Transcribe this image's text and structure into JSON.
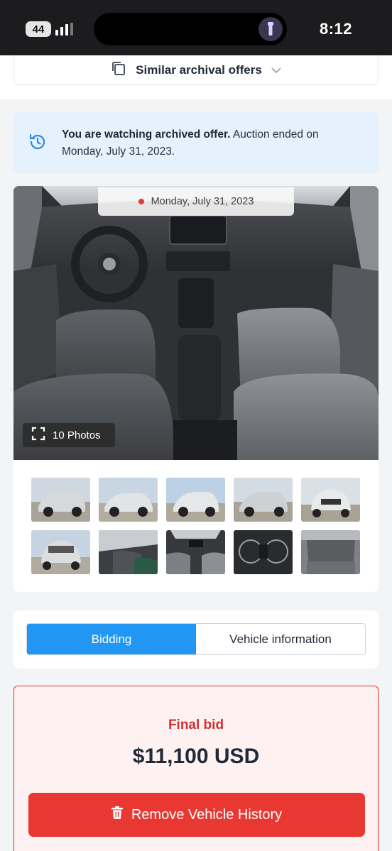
{
  "status_bar": {
    "battery": "44",
    "time": "8:12"
  },
  "similar": {
    "label": "Similar archival offers"
  },
  "alert": {
    "bold": "You are watching archived offer.",
    "rest": " Auction ended on Monday, July 31, 2023."
  },
  "gallery": {
    "date": "Monday, July 31, 2023",
    "photos_label": "10 Photos",
    "thumbnail_count": 10
  },
  "tabs": [
    {
      "label": "Bidding",
      "active": true
    },
    {
      "label": "Vehicle information",
      "active": false
    }
  ],
  "bid": {
    "label": "Final bid",
    "value": "$11,100 USD",
    "button": "Remove Vehicle History"
  },
  "colors": {
    "accent_blue": "#2196f3",
    "alert_bg": "#e5f1fc",
    "danger_red": "#e93832",
    "bid_label_red": "#d32f2f"
  },
  "icons": [
    "battery-icon",
    "signal-icon",
    "flashlight-icon",
    "copy-icon",
    "chevron-down-icon",
    "history-icon",
    "red-dot-icon",
    "expand-icon",
    "trash-icon"
  ]
}
